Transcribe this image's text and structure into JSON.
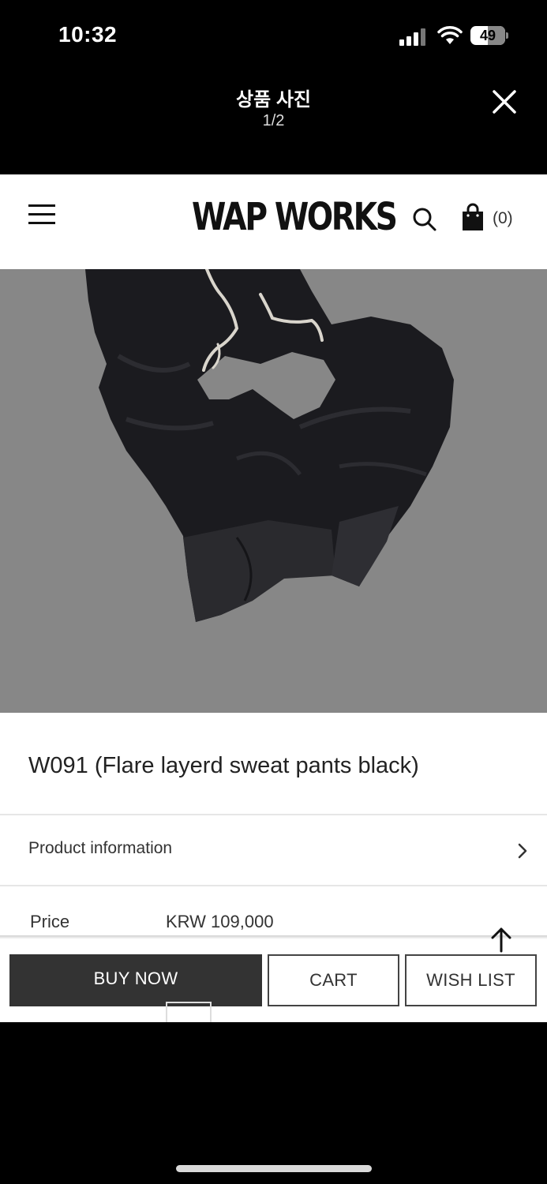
{
  "status_bar": {
    "time": "10:32",
    "battery": "49",
    "battery_level_percent": 49
  },
  "viewer": {
    "title": "상품 사진",
    "counter": "1/2",
    "close_icon": "close-icon"
  },
  "site": {
    "logo": "WAP WORKS",
    "cart_count": "(0)",
    "icons": [
      "menu-icon",
      "search-icon",
      "shopping-bag-icon"
    ]
  },
  "product": {
    "title": "W091 (Flare layerd sweat pants black)",
    "image_alt": "Black flare layered sweat pants on grey background",
    "info_label": "Product information",
    "price_label": "Price",
    "price_value": "KRW 109,000"
  },
  "actions": {
    "buy_now": "BUY NOW",
    "cart": "CART",
    "wish_list": "WISH LIST"
  },
  "colors": {
    "image_background": "#878787",
    "buy_button": "#333333"
  }
}
